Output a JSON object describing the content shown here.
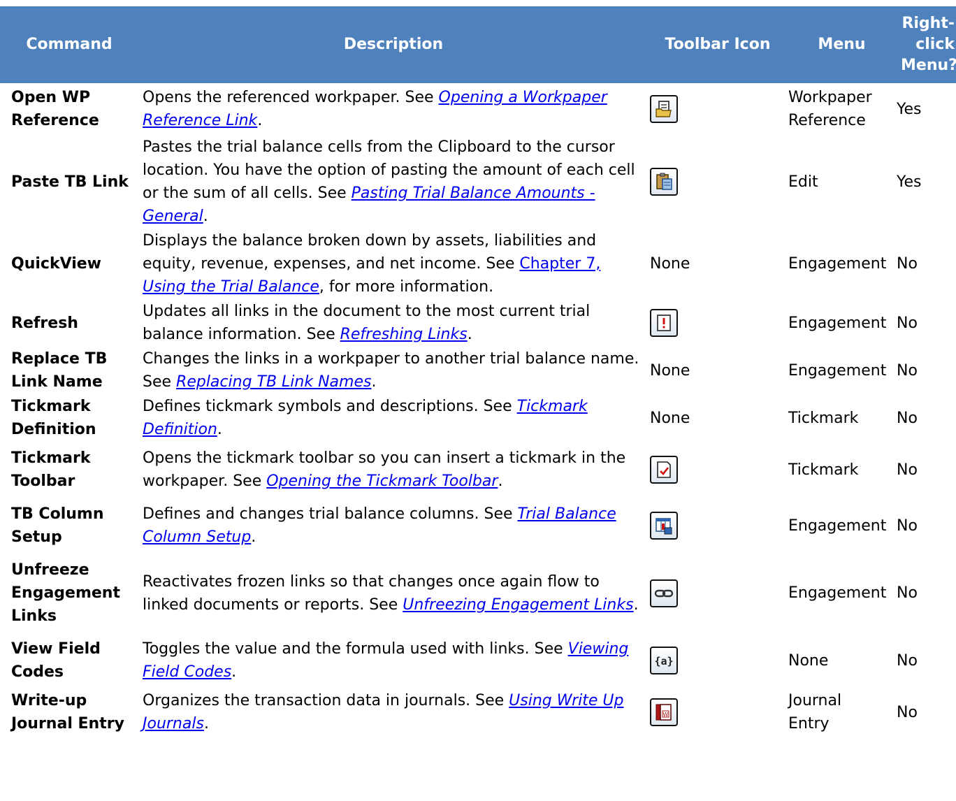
{
  "headers": {
    "command": "Command",
    "description": "Description",
    "toolbar_icon": "Toolbar Icon",
    "menu": "Menu",
    "right_click_line1": "Right-",
    "right_click_line2": "click",
    "right_click_line3": "Menu?"
  },
  "rows": [
    {
      "command": "Open WP Reference",
      "desc": "Opens the referenced workpaper. See ",
      "link": "Opening a Workpaper Reference Link",
      "after": ".",
      "icon": "open-workpaper-icon",
      "icon_text": "",
      "menu": "Workpaper Reference",
      "right_click": "Yes"
    },
    {
      "command": "Paste TB Link",
      "desc": "Pastes the trial balance cells from the Clipboard to the cursor location. You have the option of pasting the amount of each cell or the sum of all cells. See ",
      "link": "Pasting Trial Balance Amounts - General",
      "after": ".",
      "icon": "paste-link-icon",
      "icon_text": "",
      "menu": "Edit",
      "right_click": "Yes"
    },
    {
      "command": "QuickView",
      "desc": "Displays the balance broken down by assets, liabilities and equity, revenue, expenses, and net income. See ",
      "link_plain": "Chapter 7, ",
      "link": "Using the Trial Balance",
      "after": ", for more information.",
      "icon": "",
      "icon_text": "None",
      "menu": "Engagement",
      "right_click": "No"
    },
    {
      "command": "Refresh",
      "desc": "Updates all links in the document to the most current trial balance information. See ",
      "link": "Refreshing Links",
      "after": ".",
      "icon": "refresh-icon",
      "icon_text": "",
      "menu": "Engagement",
      "right_click": "No"
    },
    {
      "command": "Replace TB Link Name",
      "desc": "Changes the links in a workpaper to another trial balance name. See ",
      "link": "Replacing TB Link Names",
      "after": ".",
      "icon": "",
      "icon_text": "None",
      "menu": "Engagement",
      "right_click": "No"
    },
    {
      "command": "Tickmark Definition",
      "desc": "Defines tickmark symbols and descriptions. See ",
      "link": "Tickmark Definition",
      "after": ".",
      "icon": "",
      "icon_text": "None",
      "menu": "Tickmark",
      "right_click": "No"
    },
    {
      "command": "Tickmark Toolbar",
      "desc": "Opens the tickmark toolbar so you can insert a tickmark in the workpaper. See ",
      "link": "Opening the Tickmark Toolbar",
      "after": ".",
      "icon": "tickmark-icon",
      "icon_text": "",
      "menu": "Tickmark",
      "right_click": "No"
    },
    {
      "command": "TB Column Setup",
      "desc": "Defines and changes trial balance columns. See ",
      "link": "Trial Balance Column Setup",
      "after": ".",
      "icon": "column-setup-icon",
      "icon_text": "",
      "menu": "Engagement",
      "right_click": "No"
    },
    {
      "command": "Unfreeze Engagement Links",
      "desc": "Reactivates frozen links so that changes once again flow to linked documents or reports. See ",
      "link": "Unfreezing Engagement Links",
      "after": ".",
      "icon": "chain-link-icon",
      "icon_text": "",
      "menu": "Engagement",
      "right_click": "No"
    },
    {
      "command": "View Field Codes",
      "desc": "Toggles the value and the formula used with links. See ",
      "link": "Viewing Field Codes",
      "after": ".",
      "icon": "field-code-icon",
      "icon_text": "",
      "menu": "None",
      "right_click": "No"
    },
    {
      "command": "Write-up Journal Entry",
      "desc": "Organizes the transaction data in journals. See ",
      "link": "Using Write Up Journals",
      "after": ".",
      "icon": "journal-icon",
      "icon_text": "",
      "menu": "Journal Entry",
      "right_click": "No"
    }
  ]
}
